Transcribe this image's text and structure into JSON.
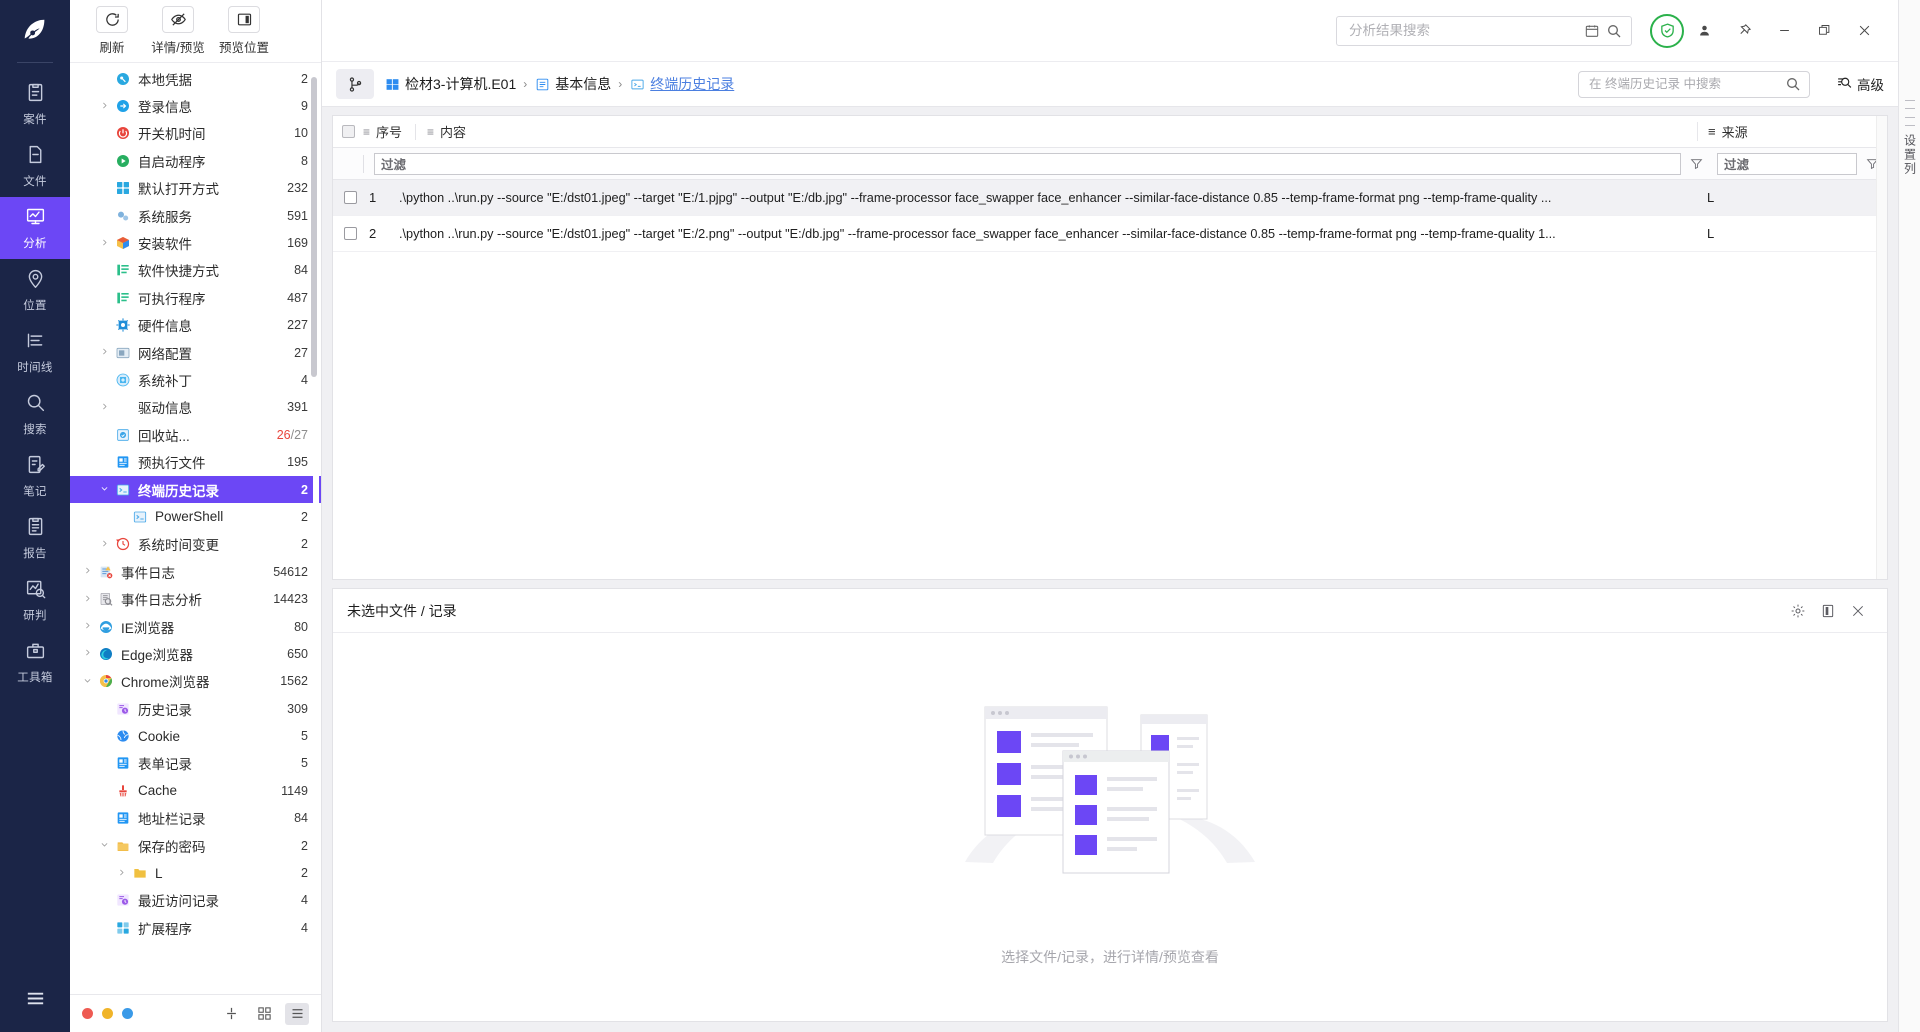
{
  "rail": {
    "logo_icon": "app-logo-icon",
    "items": [
      {
        "label": "案件",
        "icon": "case-clipboard-icon",
        "active": false
      },
      {
        "label": "文件",
        "icon": "file-icon",
        "active": false
      },
      {
        "label": "分析",
        "icon": "analysis-chart-icon",
        "active": true
      },
      {
        "label": "位置",
        "icon": "location-pin-icon",
        "active": false
      },
      {
        "label": "时间线",
        "icon": "timeline-icon",
        "active": false
      },
      {
        "label": "搜索",
        "icon": "search-icon",
        "active": false
      },
      {
        "label": "笔记",
        "icon": "notes-pencil-icon",
        "active": false
      },
      {
        "label": "报告",
        "icon": "report-clipboard-icon",
        "active": false
      },
      {
        "label": "研判",
        "icon": "insight-magnifier-icon",
        "active": false
      },
      {
        "label": "工具箱",
        "icon": "toolbox-icon",
        "active": false
      }
    ],
    "menu_icon": "hamburger-menu-icon"
  },
  "toolbar": {
    "buttons": [
      {
        "label": "刷新",
        "icon": "refresh-icon"
      },
      {
        "label": "详情/预览",
        "icon": "eye-off-icon"
      },
      {
        "label": "预览位置",
        "icon": "panel-layout-icon"
      }
    ]
  },
  "tree": [
    {
      "label": "本地凭据",
      "count": "2",
      "icon": "key-icon",
      "color": "#29a8e0",
      "indent": 1,
      "caret": "none",
      "selected": false
    },
    {
      "label": "登录信息",
      "count": "9",
      "icon": "login-arrow-icon",
      "color": "#1fa2e8",
      "indent": 1,
      "caret": "right",
      "selected": false
    },
    {
      "label": "开关机时间",
      "count": "10",
      "icon": "power-icon",
      "color": "#e8453c",
      "indent": 1,
      "caret": "none",
      "selected": false
    },
    {
      "label": "自启动程序",
      "count": "8",
      "icon": "play-icon",
      "color": "#27ae60",
      "indent": 1,
      "caret": "none",
      "selected": false
    },
    {
      "label": "默认打开方式",
      "count": "232",
      "icon": "grid-apps-icon",
      "color": "#29a8e0",
      "indent": 1,
      "caret": "none",
      "selected": false
    },
    {
      "label": "系统服务",
      "count": "591",
      "icon": "gears-icon",
      "color": "#7fb2dd",
      "indent": 1,
      "caret": "none",
      "selected": false
    },
    {
      "label": "安装软件",
      "count": "169",
      "icon": "package-box-icon",
      "color": "#f0a830",
      "indent": 1,
      "caret": "right",
      "selected": false
    },
    {
      "label": "软件快捷方式",
      "count": "84",
      "icon": "list-green-icon",
      "color": "#2bbf8a",
      "indent": 1,
      "caret": "none",
      "selected": false
    },
    {
      "label": "可执行程序",
      "count": "487",
      "icon": "list-green-icon",
      "color": "#2bbf8a",
      "indent": 1,
      "caret": "none",
      "selected": false
    },
    {
      "label": "硬件信息",
      "count": "227",
      "icon": "cpu-chip-icon",
      "color": "#1f8ed8",
      "indent": 1,
      "caret": "none",
      "selected": false
    },
    {
      "label": "网络配置",
      "count": "27",
      "icon": "network-card-icon",
      "color": "#8aa7bf",
      "indent": 1,
      "caret": "right",
      "selected": false
    },
    {
      "label": "系统补丁",
      "count": "4",
      "icon": "patch-plus-icon",
      "color": "#49b6f0",
      "indent": 1,
      "caret": "none",
      "selected": false
    },
    {
      "label": "驱动信息",
      "count": "391",
      "icon": "driver-drop-icon",
      "color": "#1f78d8",
      "indent": 1,
      "caret": "right",
      "selected": false
    },
    {
      "label": "回收站...",
      "count": "26",
      "count2": "/27",
      "icon": "recycle-bin-icon",
      "color": "#3da5e8",
      "indent": 1,
      "caret": "none",
      "selected": false
    },
    {
      "label": "预执行文件",
      "count": "195",
      "icon": "prefetch-file-icon",
      "color": "#2196f3",
      "indent": 1,
      "caret": "none",
      "selected": false
    },
    {
      "label": "终端历史记录",
      "count": "2",
      "icon": "terminal-icon",
      "color": "#4aa8e8",
      "indent": 1,
      "caret": "down",
      "selected": true
    },
    {
      "label": "PowerShell",
      "count": "2",
      "icon": "terminal-icon",
      "color": "#4aa8e8",
      "indent": 2,
      "caret": "none",
      "selected": false
    },
    {
      "label": "系统时间变更",
      "count": "2",
      "icon": "clock-back-icon",
      "color": "#e8453c",
      "indent": 1,
      "caret": "right",
      "selected": false
    },
    {
      "label": "事件日志",
      "count": "54612",
      "icon": "event-log-icon",
      "color": "#5f9bd8",
      "indent": 0,
      "caret": "right",
      "selected": false
    },
    {
      "label": "事件日志分析",
      "count": "14423",
      "icon": "log-analysis-icon",
      "color": "#8c8c92",
      "indent": 0,
      "caret": "right",
      "selected": false
    },
    {
      "label": "IE浏览器",
      "count": "80",
      "icon": "ie-browser-icon",
      "color": "#29a8e0",
      "indent": 0,
      "caret": "right",
      "selected": false
    },
    {
      "label": "Edge浏览器",
      "count": "650",
      "icon": "edge-browser-icon",
      "color": "#1f8ed8",
      "indent": 0,
      "caret": "right",
      "selected": false
    },
    {
      "label": "Chrome浏览器",
      "count": "1562",
      "icon": "chrome-browser-icon",
      "color": "#e8453c",
      "indent": 0,
      "caret": "down",
      "selected": false
    },
    {
      "label": "历史记录",
      "count": "309",
      "icon": "history-clock-icon",
      "color": "#9b59e8",
      "indent": 1,
      "caret": "none",
      "selected": false
    },
    {
      "label": "Cookie",
      "count": "5",
      "icon": "cookie-globe-icon",
      "color": "#1f8ed8",
      "indent": 1,
      "caret": "none",
      "selected": false
    },
    {
      "label": "表单记录",
      "count": "5",
      "icon": "form-record-icon",
      "color": "#2196f3",
      "indent": 1,
      "caret": "none",
      "selected": false
    },
    {
      "label": "Cache",
      "count": "1149",
      "icon": "cache-broom-icon",
      "color": "#e8453c",
      "indent": 1,
      "caret": "none",
      "selected": false
    },
    {
      "label": "地址栏记录",
      "count": "84",
      "icon": "address-bar-icon",
      "color": "#2196f3",
      "indent": 1,
      "caret": "none",
      "selected": false
    },
    {
      "label": "保存的密码",
      "count": "2",
      "icon": "saved-password-icon",
      "color": "#f0a830",
      "indent": 1,
      "caret": "down",
      "selected": false
    },
    {
      "label": "L",
      "count": "2",
      "icon": "folder-icon",
      "color": "#f0c040",
      "indent": 2,
      "caret": "right",
      "selected": false
    },
    {
      "label": "最近访问记录",
      "count": "4",
      "icon": "recent-visit-icon",
      "color": "#9b59e8",
      "indent": 1,
      "caret": "none",
      "selected": false
    },
    {
      "label": "扩展程序",
      "count": "4",
      "icon": "extension-icon",
      "color": "#29a8e0",
      "indent": 1,
      "caret": "none",
      "selected": false
    }
  ],
  "tree_footer": {
    "dots": [
      "#ee5a52",
      "#f0b429",
      "#3a9ae8"
    ],
    "icons": [
      "split-view-icon",
      "grid-view-icon",
      "list-view-icon"
    ],
    "active_icon": "list-view-icon"
  },
  "titlebar": {
    "search": {
      "placeholder": "分析结果搜索",
      "value": "",
      "calendar_icon": "calendar-icon",
      "search_icon": "search-icon"
    },
    "shield_icon": "shield-check-icon",
    "window_buttons": [
      {
        "icon": "user-icon",
        "name": "user-button"
      },
      {
        "icon": "pin-icon",
        "name": "pin-button"
      },
      {
        "icon": "minimize-icon",
        "name": "minimize-button"
      },
      {
        "icon": "maximize-icon",
        "name": "maximize-button"
      },
      {
        "icon": "close-icon",
        "name": "close-button"
      }
    ]
  },
  "breadcrumb": {
    "branch_icon": "branch-icon",
    "items": [
      {
        "label": "检材3-计算机.E01",
        "icon": "windows-icon",
        "link": false
      },
      {
        "label": "基本信息",
        "icon": "info-list-icon",
        "link": false
      },
      {
        "label": "终端历史记录",
        "icon": "terminal-icon",
        "link": true
      }
    ],
    "separator": "›",
    "search": {
      "placeholder": "在 终端历史记录 中搜索",
      "value": "",
      "icon": "search-icon"
    },
    "advanced": {
      "label": "高级",
      "icon": "advanced-search-icon"
    }
  },
  "grid": {
    "columns": [
      {
        "key": "index",
        "label": "序号",
        "menu_icon": "column-menu-icon"
      },
      {
        "key": "content",
        "label": "内容",
        "menu_icon": "column-menu-icon"
      },
      {
        "key": "source",
        "label": "来源",
        "menu_icon": "column-menu-icon"
      }
    ],
    "filter": {
      "content_placeholder": "过滤",
      "source_placeholder": "过滤",
      "funnel_icon": "funnel-icon"
    },
    "rows": [
      {
        "index": "1",
        "content": ".\\python ..\\run.py --source \"E:/dst01.jpeg\" --target \"E:/1.pjpg\" --output \"E:/db.jpg\" --frame-processor face_swapper face_enhancer --similar-face-distance 0.85 --temp-frame-format png --temp-frame-quality ...",
        "source": "L",
        "checked": false
      },
      {
        "index": "2",
        "content": ".\\python ..\\run.py --source \"E:/dst01.jpeg\" --target \"E:/2.png\" --output \"E:/db.jpg\" --frame-processor face_swapper face_enhancer --similar-face-distance 0.85 --temp-frame-format png --temp-frame-quality 1...",
        "source": "L",
        "checked": false
      }
    ]
  },
  "preview": {
    "title": "未选中文件 / 记录",
    "caption": "选择文件/记录，进行详情/预览查看",
    "icons": [
      {
        "name": "settings-gear-icon"
      },
      {
        "name": "panel-layout-icon"
      },
      {
        "name": "close-icon"
      }
    ]
  },
  "right_strip": {
    "label": "设置列",
    "grip_icon": "drag-grip-icon"
  },
  "colors": {
    "accent": "#6C47F5",
    "rail_bg": "#1b2547",
    "link": "#4b7fe0",
    "danger": "#e8453c",
    "green": "#2bb14b"
  }
}
